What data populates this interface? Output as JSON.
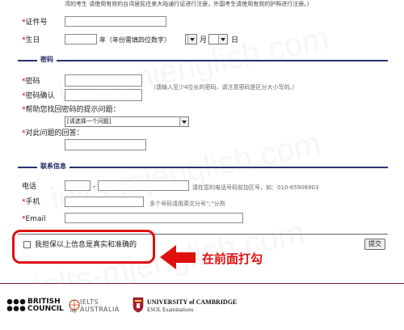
{
  "notice_line": "湾的考生 请使用有效的台湾居民往来大陆通行证进行注册，外国考生请使用有效的护照进行注册。）",
  "id_field": {
    "label": "证件号",
    "value": ""
  },
  "dob": {
    "label": "生日",
    "year_value": "",
    "year_hint": "年（年份需填四位数字）",
    "month_label": "月",
    "day_label": "日",
    "month_value": "",
    "day_value": ""
  },
  "section_password": "密码",
  "password": {
    "label": "密码",
    "value": "",
    "hint": "（请输入至少4位长的密码，请注意密码是区分大小写的。）"
  },
  "password_confirm": {
    "label": "密码确认",
    "value": ""
  },
  "security_question": {
    "label": "帮助您找回密码的提示问题：",
    "selected": "[请选择一个问题]"
  },
  "security_answer": {
    "label": "对此问题的回答：",
    "value": ""
  },
  "section_contact": "联系信息",
  "phone": {
    "label": "电话",
    "area_value": "",
    "dash": "-",
    "number_value": "",
    "hint": "请在您的电话号码前加区号，如：010-65906903"
  },
  "mobile": {
    "label": "手机",
    "value": "",
    "hint": "多个号码请用英文分号“;”分割"
  },
  "email": {
    "label": "Email",
    "value": ""
  },
  "guarantee": {
    "label": "我担保以上信息是真实和准确的",
    "checked": false
  },
  "submit_label": "提交",
  "annotation": "在前面打勾",
  "watermark": "ielts-mjenglish.com",
  "logos": {
    "british_council": [
      "BRITISH",
      "COUNCIL"
    ],
    "idp": [
      "IELTS",
      "AUSTRALIA"
    ],
    "idp_small": "idp",
    "cambridge_title": "UNIVERSITY of CAMBRIDGE",
    "cambridge_sub": "ESOL Examinations"
  },
  "colors": {
    "accent_navy": "#2a3170",
    "annotation_red": "#e01010",
    "required_star": "#c00000"
  }
}
